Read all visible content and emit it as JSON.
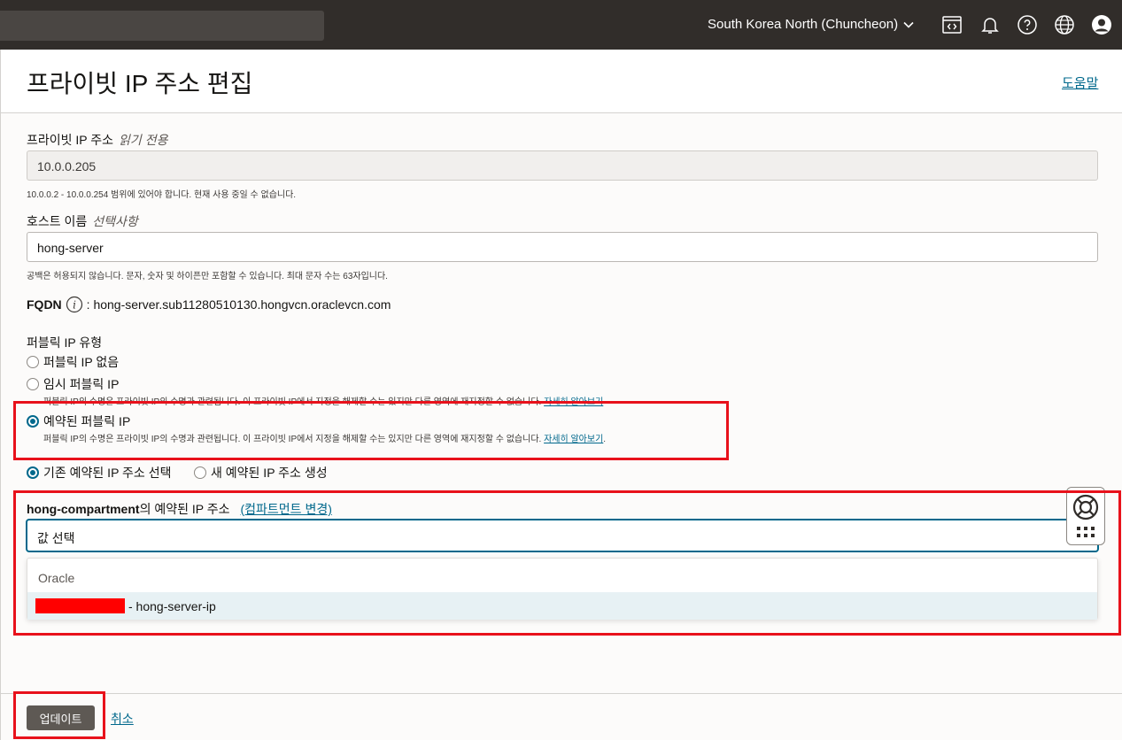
{
  "topbar": {
    "region": "South Korea North (Chuncheon)",
    "icons": [
      "code-editor-icon",
      "bell-icon",
      "help-icon",
      "globe-icon",
      "user-icon"
    ]
  },
  "page": {
    "title": "프라이빗 IP 주소 편집",
    "help_link": "도움말"
  },
  "private_ip": {
    "label": "프라이빗 IP 주소",
    "qualifier": "읽기 전용",
    "value": "10.0.0.205",
    "hint": "10.0.0.2 - 10.0.0.254 범위에 있어야 합니다. 현재 사용 중일 수 없습니다."
  },
  "hostname": {
    "label": "호스트 이름",
    "qualifier": "선택사항",
    "value": "hong-server",
    "hint": "공백은 허용되지 않습니다. 문자, 숫자 및 하이픈만 포함할 수 있습니다. 최대 문자 수는 63자입니다."
  },
  "fqdn": {
    "label": "FQDN",
    "value": ": hong-server.sub11280510130.hongvcn.oraclevcn.com"
  },
  "public_ip_type": {
    "label": "퍼블릭 IP 유형",
    "options": [
      {
        "label": "퍼블릭 IP 없음",
        "selected": false,
        "description": ""
      },
      {
        "label": "임시 퍼블릭 IP",
        "selected": false,
        "description": "퍼블릭 IP의 수명은 프라이빗 IP의 수명과 관련됩니다. 이 프라이빗 IP에서 지정을 해제할 수는 있지만 다른 영역에 재지정할 수 없습니다.",
        "link": "자세히 알아보기"
      },
      {
        "label": "예약된 퍼블릭 IP",
        "selected": true,
        "description": "퍼블릭 IP의 수명은 프라이빗 IP의 수명과 관련됩니다. 이 프라이빗 IP에서 지정을 해제할 수는 있지만 다른 영역에 재지정할 수 없습니다.",
        "link": "자세히 알아보기"
      }
    ]
  },
  "reserved_choice": {
    "existing": "기존 예약된 IP 주소 선택",
    "new": "새 예약된 IP 주소 생성",
    "selected": "existing"
  },
  "reserved_ip": {
    "compartment": "hong-compartment",
    "label_suffix": "의 예약된 IP 주소",
    "change_link": "(컴파트먼트 변경)",
    "placeholder": "값 선택",
    "dropdown_group": "Oracle",
    "dropdown_option": "- hong-server-ip"
  },
  "footer": {
    "update_button": "업데이트",
    "cancel_link": "취소"
  }
}
